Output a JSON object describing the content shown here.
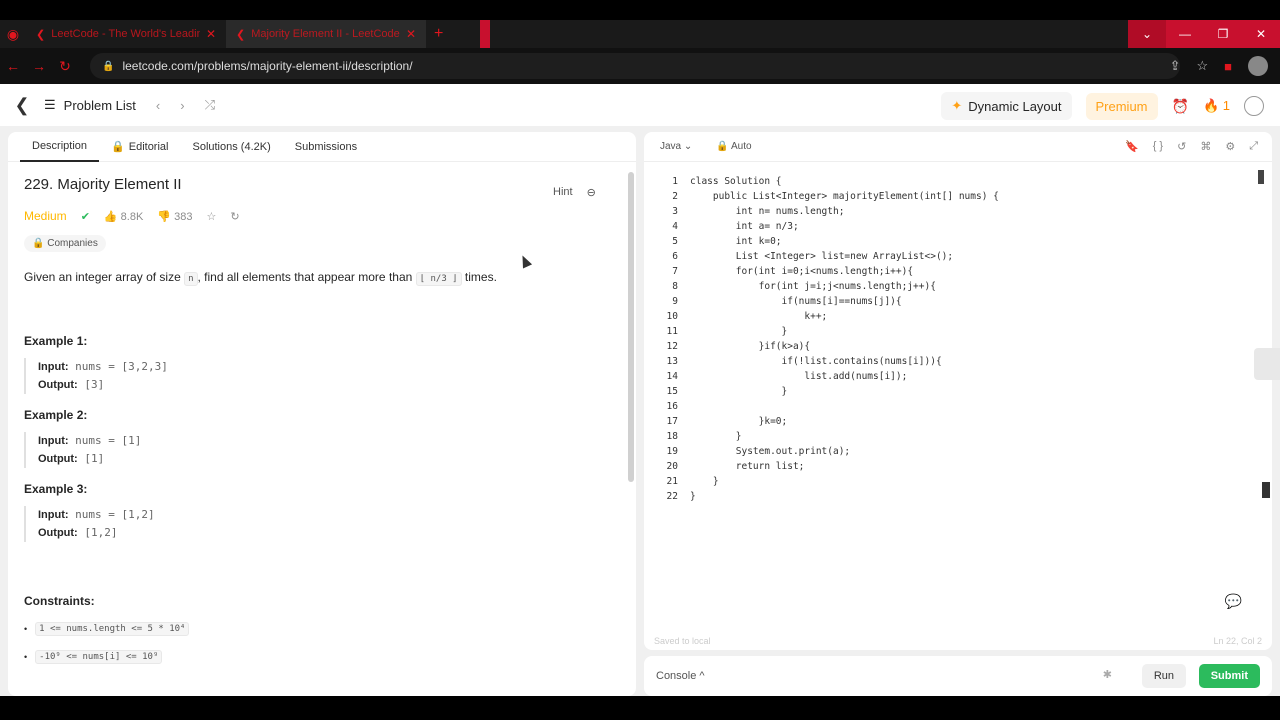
{
  "browser": {
    "tabs": [
      {
        "title": "LeetCode - The World's Leading...",
        "close": "✕"
      },
      {
        "title": "Majority Element II - LeetCode",
        "close": "✕"
      }
    ],
    "new_tab": "+",
    "url": "leetcode.com/problems/majority-element-ii/description/"
  },
  "topnav": {
    "problem_list": "Problem List",
    "dynamic_layout": "Dynamic Layout",
    "premium": "Premium",
    "streak": "1"
  },
  "tabs": {
    "description": "Description",
    "editorial": "Editorial",
    "solutions": "Solutions (4.2K)",
    "submissions": "Submissions"
  },
  "problem": {
    "title": "229. Majority Element II",
    "hint": "Hint",
    "difficulty": "Medium",
    "likes": "8.8K",
    "dislikes": "383",
    "companies": "Companies",
    "desc_pre": "Given an integer array of size ",
    "desc_code1": "n",
    "desc_mid": ", find all elements that appear more than ",
    "desc_code2": "⌊ n/3 ⌋",
    "desc_post": " times.",
    "examples": [
      {
        "h": "Example 1:",
        "input": "nums = [3,2,3]",
        "output": "[3]"
      },
      {
        "h": "Example 2:",
        "input": "nums = [1]",
        "output": "[1]"
      },
      {
        "h": "Example 3:",
        "input": "nums = [1,2]",
        "output": "[1,2]"
      }
    ],
    "input_label": "Input:",
    "output_label": "Output:",
    "constraints": "Constraints:",
    "c1": "1 <= nums.length <= 5 * 10⁴",
    "c2": "-10⁹ <= nums[i] <= 10⁹"
  },
  "editor": {
    "lang": "Java",
    "mode": "Auto",
    "saved": "Saved to local",
    "pos": "Ln 22, Col 2",
    "lines": [
      "class Solution {",
      "    public List<Integer> majorityElement(int[] nums) {",
      "        int n= nums.length;",
      "        int a= n/3;",
      "        int k=0;",
      "        List <Integer> list=new ArrayList<>();",
      "        for(int i=0;i<nums.length;i++){",
      "            for(int j=i;j<nums.length;j++){",
      "                if(nums[i]==nums[j]){",
      "                    k++;",
      "                }",
      "            }if(k>a){",
      "                if(!list.contains(nums[i])){",
      "                    list.add(nums[i]);",
      "                }",
      "",
      "            }k=0;",
      "        }",
      "        System.out.print(a);",
      "        return list;",
      "    }",
      "}"
    ]
  },
  "console": {
    "label": "Console ^",
    "run": "Run",
    "submit": "Submit"
  }
}
